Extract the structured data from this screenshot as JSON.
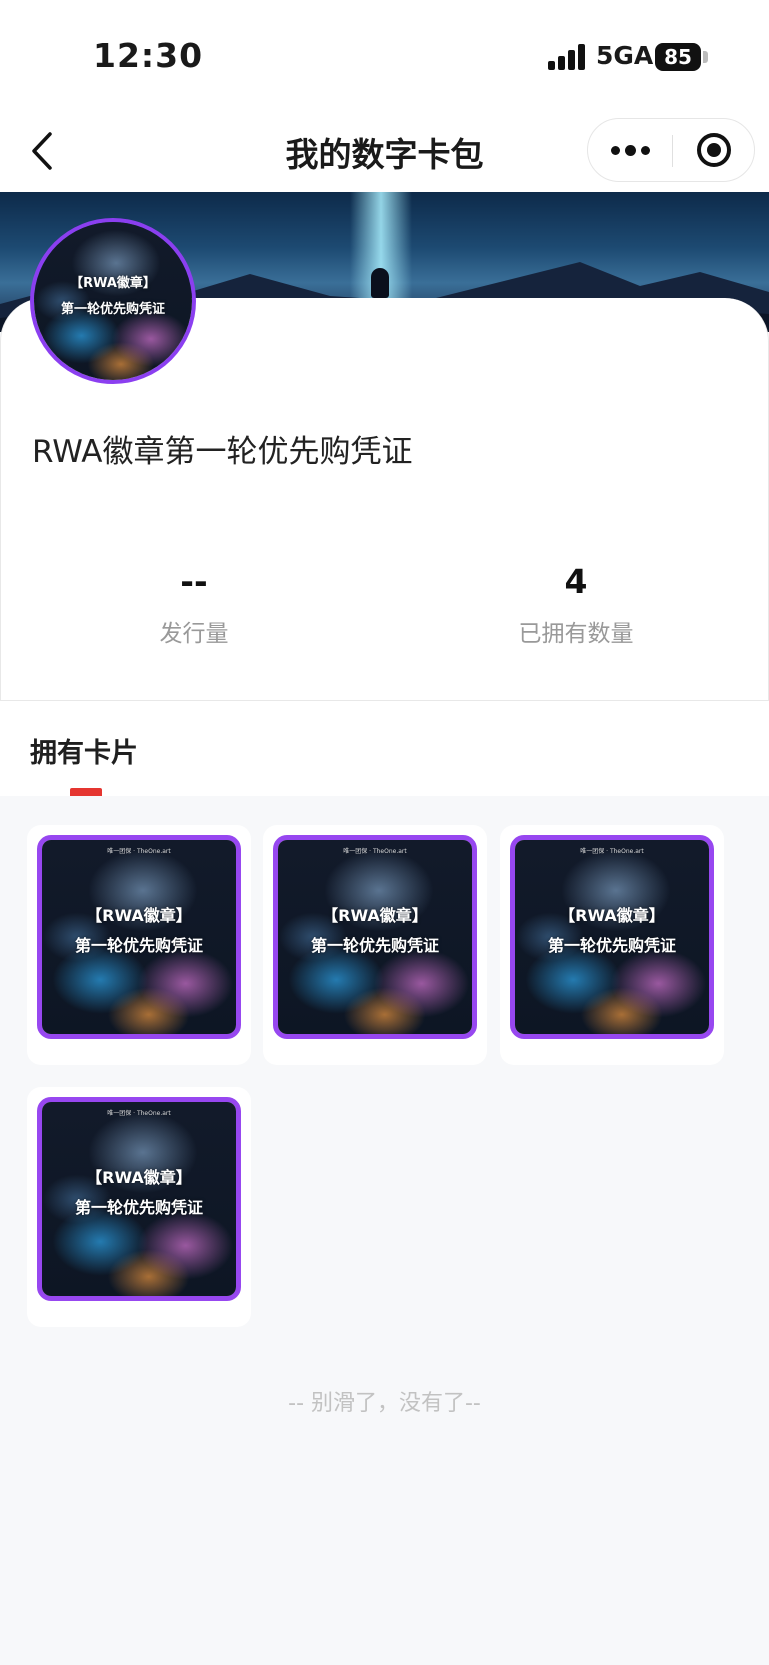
{
  "status_bar": {
    "time": "12:30",
    "network": "5GA",
    "battery": "85"
  },
  "nav": {
    "title": "我的数字卡包",
    "back_icon": "chevron-left-icon",
    "more_icon": "more-dots-icon",
    "close_icon": "target-circle-icon"
  },
  "collection": {
    "name": "RWA徽章第一轮优先购凭证",
    "art_tag": "唯一团保 · TheOne.art",
    "art_line1": "【RWA徽章】",
    "art_line2": "第一轮优先购凭证",
    "stats": [
      {
        "value": "--",
        "label": "发行量"
      },
      {
        "value": "4",
        "label": "已拥有数量"
      }
    ]
  },
  "owned": {
    "section_title": "拥有卡片",
    "count": 4,
    "end_text": "-- 别滑了，没有了--"
  },
  "colors": {
    "accent_purple": "#9747f0",
    "tab_indicator": "#e53530",
    "background": "#f7f8fa"
  }
}
